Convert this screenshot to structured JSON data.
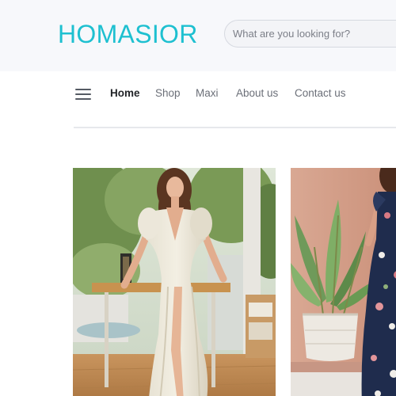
{
  "header": {
    "logo": "HOMASIOR",
    "search": {
      "placeholder": "What are you looking for?",
      "value": ""
    }
  },
  "nav": {
    "items": [
      {
        "label": "Home",
        "active": true
      },
      {
        "label": "Shop",
        "active": false
      },
      {
        "label": "Maxi",
        "active": false
      },
      {
        "label": "About us",
        "active": false
      },
      {
        "label": "Contact us",
        "active": false
      }
    ],
    "menu_icon": "hamburger-menu-icon"
  },
  "products": [
    {
      "image": "woman-in-cream-maxi-dress-photo"
    },
    {
      "image": "woman-in-navy-floral-maxi-dress-photo"
    }
  ],
  "colors": {
    "brand": "#1ec0d0",
    "header_bg": "#f7f8fb",
    "nav_active": "#222428",
    "nav_text": "#6b6f78"
  }
}
